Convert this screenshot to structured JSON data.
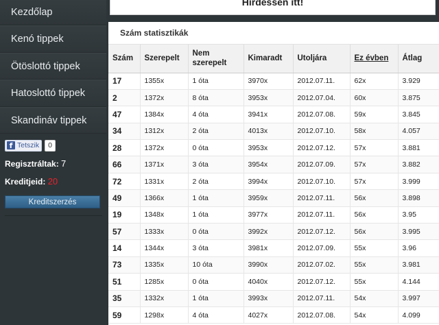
{
  "sidebar": {
    "nav": [
      "Kezdőlap",
      "Kenó tippek",
      "Ötöslottó tippek",
      "Hatoslottó tippek",
      "Skandináv tippek"
    ],
    "fb_like_label": "Tetszik",
    "fb_like_count": "0",
    "registered_label": "Regisztráltak:",
    "registered_value": "7",
    "credits_label": "Kreditjeid:",
    "credits_value": "20",
    "credit_button": "Kreditszerzés"
  },
  "ad": {
    "text": "Hirdessen itt!"
  },
  "stats": {
    "title": "Szám statisztikák",
    "headers": [
      "Szám",
      "Szerepelt",
      "Nem szerepelt",
      "Kimaradt",
      "Utoljára",
      "Ez évben",
      "Átlag"
    ],
    "rows": [
      [
        "17",
        "1355x",
        "1 óta",
        "3970x",
        "2012.07.11.",
        "62x",
        "3.929"
      ],
      [
        "2",
        "1372x",
        "8 óta",
        "3953x",
        "2012.07.04.",
        "60x",
        "3.875"
      ],
      [
        "47",
        "1384x",
        "4 óta",
        "3941x",
        "2012.07.08.",
        "59x",
        "3.845"
      ],
      [
        "34",
        "1312x",
        "2 óta",
        "4013x",
        "2012.07.10.",
        "58x",
        "4.057"
      ],
      [
        "28",
        "1372x",
        "0 óta",
        "3953x",
        "2012.07.12.",
        "57x",
        "3.881"
      ],
      [
        "66",
        "1371x",
        "3 óta",
        "3954x",
        "2012.07.09.",
        "57x",
        "3.882"
      ],
      [
        "72",
        "1331x",
        "2 óta",
        "3994x",
        "2012.07.10.",
        "57x",
        "3.999"
      ],
      [
        "49",
        "1366x",
        "1 óta",
        "3959x",
        "2012.07.11.",
        "56x",
        "3.898"
      ],
      [
        "19",
        "1348x",
        "1 óta",
        "3977x",
        "2012.07.11.",
        "56x",
        "3.95"
      ],
      [
        "57",
        "1333x",
        "0 óta",
        "3992x",
        "2012.07.12.",
        "56x",
        "3.995"
      ],
      [
        "14",
        "1344x",
        "3 óta",
        "3981x",
        "2012.07.09.",
        "55x",
        "3.96"
      ],
      [
        "73",
        "1335x",
        "10 óta",
        "3990x",
        "2012.07.02.",
        "55x",
        "3.981"
      ],
      [
        "51",
        "1285x",
        "0 óta",
        "4040x",
        "2012.07.12.",
        "55x",
        "4.144"
      ],
      [
        "35",
        "1332x",
        "1 óta",
        "3993x",
        "2012.07.11.",
        "54x",
        "3.997"
      ],
      [
        "59",
        "1298x",
        "4 óta",
        "4027x",
        "2012.07.08.",
        "54x",
        "4.099"
      ]
    ]
  }
}
